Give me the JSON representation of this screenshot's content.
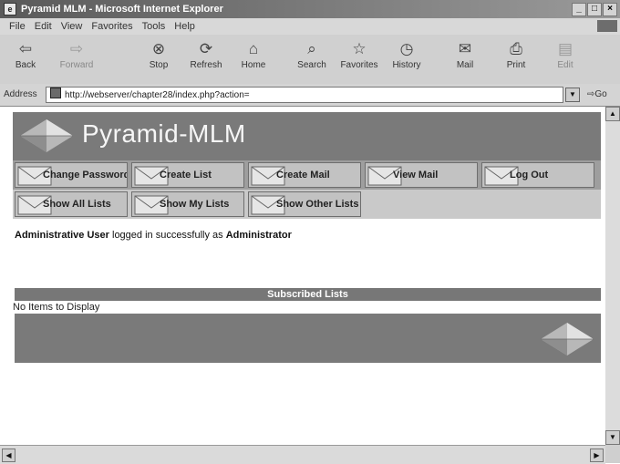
{
  "window": {
    "title": "Pyramid MLM - Microsoft Internet Explorer"
  },
  "menubar": {
    "items": [
      "File",
      "Edit",
      "View",
      "Favorites",
      "Tools",
      "Help"
    ]
  },
  "toolbar": {
    "back": "Back",
    "forward": "Forward",
    "stop": "Stop",
    "refresh": "Refresh",
    "home": "Home",
    "search": "Search",
    "favorites": "Favorites",
    "history": "History",
    "mail": "Mail",
    "print": "Print",
    "edit": "Edit"
  },
  "address": {
    "label": "Address",
    "url": "http://webserver/chapter28/index.php?action=",
    "go": "Go"
  },
  "page": {
    "site_title": "Pyramid-MLM",
    "nav_row1": [
      "Change Password",
      "Create List",
      "Create Mail",
      "View Mail",
      "Log Out"
    ],
    "nav_row2": [
      "Show All Lists",
      "Show My Lists",
      "Show Other Lists"
    ],
    "status": {
      "user": "Administrative User",
      "middle": " logged in successfully as ",
      "account": "Administrator"
    },
    "section_title": "Subscribed Lists",
    "empty_message": "No Items to Display"
  },
  "colors": {
    "banner": "#7a7a7a",
    "nav_row": "#9e9e9e",
    "section_bar": "#777777"
  }
}
